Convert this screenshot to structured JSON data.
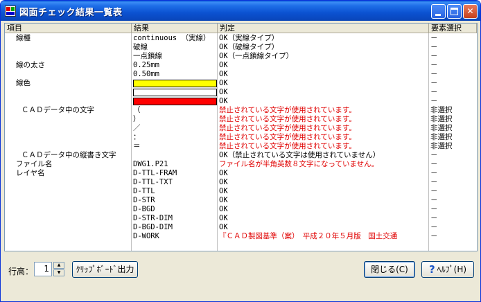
{
  "window": {
    "title": "図面チェック結果一覧表"
  },
  "columns": [
    "項目",
    "結果",
    "判定",
    "要素選択"
  ],
  "rows": [
    {
      "item": "線種",
      "result": "continuous （実線）",
      "judge": "OK（実線タイプ）",
      "sel": "－",
      "red": false
    },
    {
      "item": "",
      "result": "破線",
      "judge": "OK（破線タイプ）",
      "sel": "－",
      "red": false
    },
    {
      "item": "",
      "result": "一点鎖線",
      "judge": "OK（一点鎖線タイプ）",
      "sel": "－",
      "red": false
    },
    {
      "item": "線の太さ",
      "result": "0.25mm",
      "judge": "OK",
      "sel": "－",
      "red": false
    },
    {
      "item": "",
      "result": "0.50mm",
      "judge": "OK",
      "sel": "－",
      "red": false
    },
    {
      "item": "線色",
      "result": "",
      "swatch": "#ffff00",
      "judge": "OK",
      "sel": "－",
      "red": false
    },
    {
      "item": "",
      "result": "",
      "swatch": "#ffffff",
      "judge": "OK",
      "sel": "－",
      "red": false
    },
    {
      "item": "",
      "result": "",
      "swatch": "#ff0000",
      "judge": "OK",
      "sel": "－",
      "red": false
    },
    {
      "item": "ＣＡＤデータ中の文字",
      "result": "（",
      "judge": "禁止されている文字が使用されています。",
      "sel": "非選択",
      "red": true
    },
    {
      "item": "",
      "result": "）",
      "judge": "禁止されている文字が使用されています。",
      "sel": "非選択",
      "red": true
    },
    {
      "item": "",
      "result": "／",
      "judge": "禁止されている文字が使用されています。",
      "sel": "非選択",
      "red": true
    },
    {
      "item": "",
      "result": "：",
      "judge": "禁止されている文字が使用されています。",
      "sel": "非選択",
      "red": true
    },
    {
      "item": "",
      "result": "＝",
      "judge": "禁止されている文字が使用されています。",
      "sel": "非選択",
      "red": true
    },
    {
      "item": "ＣＡＤデータ中の縦書き文字",
      "result": "",
      "judge": "OK（禁止されている文字は使用されていません）",
      "sel": "－",
      "red": false
    },
    {
      "item": "ファイル名",
      "result": "DWG1.P21",
      "judge": "ファイル名が半角英数８文字になっていません。",
      "sel": "－",
      "red": true
    },
    {
      "item": "レイヤ名",
      "result": "D-TTL-FRAM",
      "judge": "OK",
      "sel": "－",
      "red": false
    },
    {
      "item": "",
      "result": "D-TTL-TXT",
      "judge": "OK",
      "sel": "－",
      "red": false
    },
    {
      "item": "",
      "result": "D-TTL",
      "judge": "OK",
      "sel": "－",
      "red": false
    },
    {
      "item": "",
      "result": "D-STR",
      "judge": "OK",
      "sel": "－",
      "red": false
    },
    {
      "item": "",
      "result": "D-BGD",
      "judge": "OK",
      "sel": "－",
      "red": false
    },
    {
      "item": "",
      "result": "D-STR-DIM",
      "judge": "OK",
      "sel": "－",
      "red": false
    },
    {
      "item": "",
      "result": "D-BGD-DIM",
      "judge": "OK",
      "sel": "－",
      "red": false
    },
    {
      "item": "",
      "result": "D-WORK",
      "judge": "『ＣＡＤ製図基準（案）　平成２０年５月版　国土交通",
      "sel": "－",
      "red": true
    }
  ],
  "footer": {
    "row_height_label": "行高：",
    "row_height_value": "1",
    "clipboard_button": "ｸﾘｯﾌﾟﾎﾞｰﾄﾞ出力",
    "close_button": "閉じる(C)",
    "help_button": "ﾍﾙﾌﾟ(H)"
  },
  "colors": {
    "accent": "#0a5fd8",
    "error_text": "#e00000"
  }
}
